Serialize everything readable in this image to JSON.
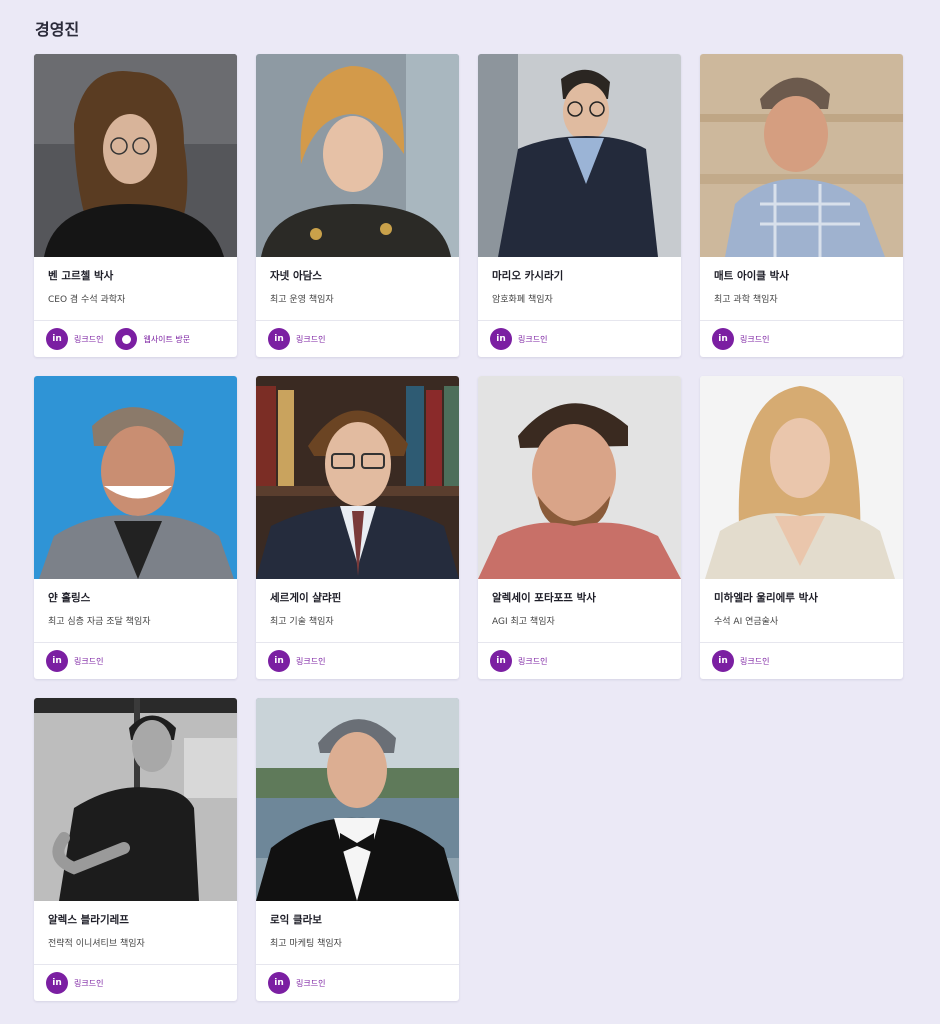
{
  "section": {
    "title": "경영진"
  },
  "links": {
    "linkedin": "링크드인",
    "website": "웹사이트 방문"
  },
  "members": [
    {
      "name": "벤 고르첼 박사",
      "role": "CEO 겸 수석 과학자",
      "website": true
    },
    {
      "name": "자넷 아담스",
      "role": "최고 운영 책임자",
      "website": false
    },
    {
      "name": "마리오 카시라기",
      "role": "암호화폐 책임자",
      "website": false
    },
    {
      "name": "매트 아이클 박사",
      "role": "최고 과학 책임자",
      "website": false
    },
    {
      "name": "얀 홀링스",
      "role": "최고 심층 자금 조달 책임자",
      "website": false
    },
    {
      "name": "세르게이 샬랴핀",
      "role": "최고 기술 책임자",
      "website": false
    },
    {
      "name": "알렉세이 포타포프 박사",
      "role": "AGI 최고 책임자",
      "website": false
    },
    {
      "name": "미하엘라 울리에루 박사",
      "role": "수석 AI 연금술사",
      "website": false
    },
    {
      "name": "알렉스 블라기레프",
      "role": "전략적 이니셔티브 책임자",
      "website": false
    },
    {
      "name": "로익 클라보",
      "role": "최고 마케팅 책임자",
      "website": false
    }
  ],
  "colors": {
    "accent": "#7b1fa2",
    "background": "#ebe9f6"
  }
}
